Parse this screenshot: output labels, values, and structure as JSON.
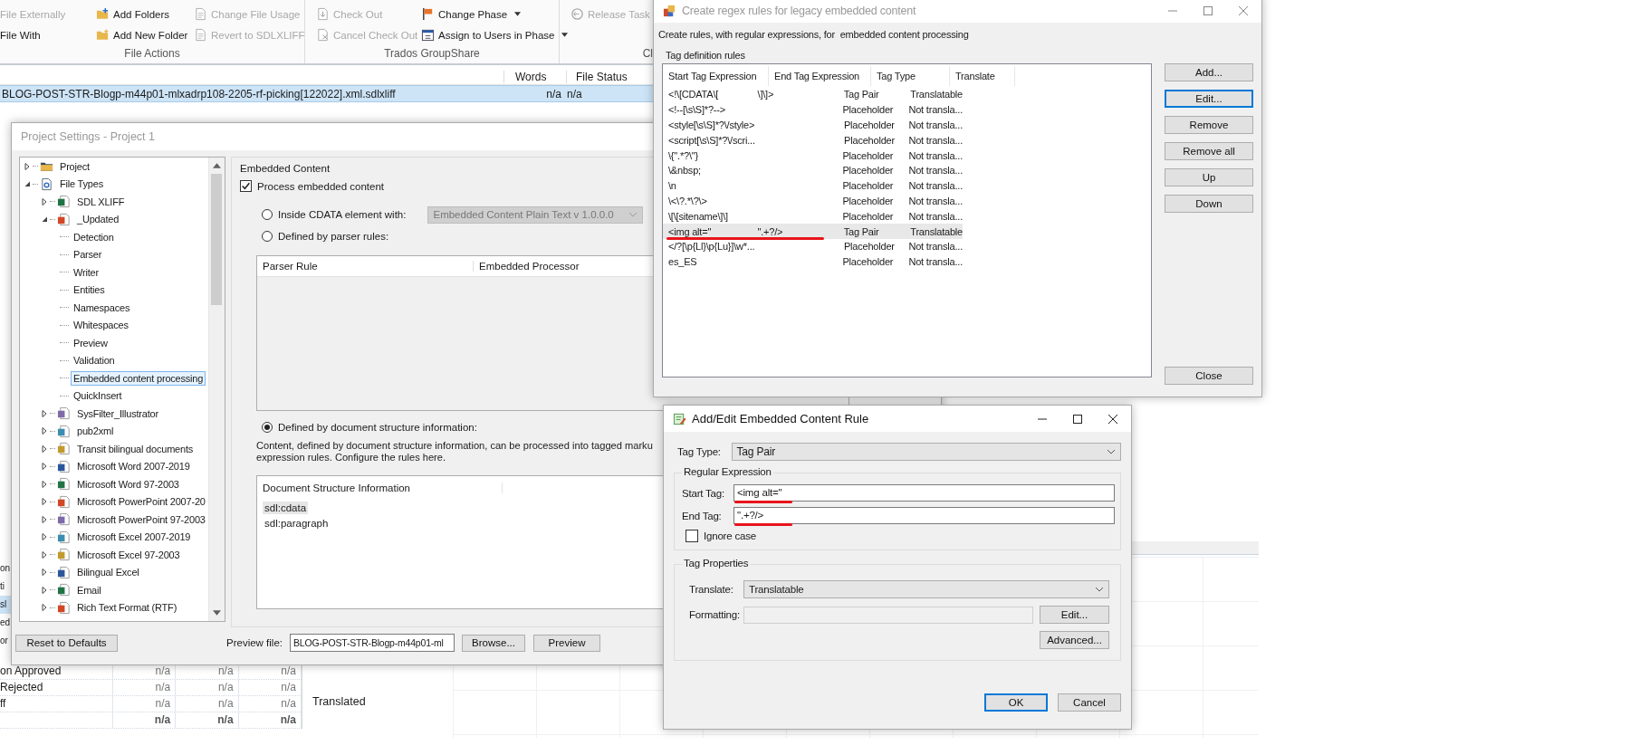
{
  "ribbon": {
    "groups": [
      {
        "label": "File Actions",
        "items": [
          {
            "label": "File Externally",
            "disabled": true,
            "dropdown": false
          },
          {
            "label": "File With",
            "disabled": false,
            "dropdown": false
          },
          {
            "label": "Add Folders",
            "disabled": false,
            "dropdown": false
          },
          {
            "label": "Add New Folder",
            "disabled": false,
            "dropdown": false
          },
          {
            "label": "Change File Usage",
            "disabled": true,
            "dropdown": false
          },
          {
            "label": "Revert to SDLXLIFF",
            "disabled": true,
            "dropdown": false
          }
        ]
      },
      {
        "label": "Trados GroupShare",
        "items": [
          {
            "label": "Check Out",
            "disabled": true,
            "dropdown": false
          },
          {
            "label": "Cancel Check Out",
            "disabled": true,
            "dropdown": false
          },
          {
            "label": "Change Phase",
            "disabled": false,
            "dropdown": true
          },
          {
            "label": "Assign to Users in Phase",
            "disabled": false,
            "dropdown": true
          }
        ]
      },
      {
        "label": "Cl",
        "items": [
          {
            "label": "Release Task",
            "disabled": true,
            "dropdown": false
          }
        ]
      }
    ]
  },
  "file_list": {
    "columns": [
      "Words",
      "File Status"
    ],
    "rows": [
      {
        "name": "BLOG-POST-STR-Blogp-m44p01-mlxadrp108-2205-rf-picking[122022].xml.sdlxliff",
        "words": "n/a",
        "file_status": "n/a",
        "selected": true
      }
    ]
  },
  "background_rows": [
    {
      "label": "on",
      "selected": false
    },
    {
      "label": "ti",
      "selected": false
    },
    {
      "label": "sl",
      "selected": true
    },
    {
      "label": "ed",
      "selected": false
    },
    {
      "label": "or",
      "selected": false
    }
  ],
  "stats_table": {
    "rows": [
      {
        "kind": "row",
        "label": "on Approved",
        "values": [
          "n/a",
          "n/a",
          "n/a"
        ]
      },
      {
        "kind": "row",
        "label": "Rejected",
        "values": [
          "n/a",
          "n/a",
          "n/a"
        ]
      },
      {
        "kind": "row",
        "label": "ff",
        "values": [
          "n/a",
          "n/a",
          "n/a"
        ]
      },
      {
        "kind": "total",
        "values": [
          "n/a",
          "n/a",
          "n/a"
        ]
      }
    ]
  },
  "status_panel": {
    "label": "Translated"
  },
  "project_settings": {
    "title": "Project Settings - Project 1",
    "active": false,
    "tree": [
      {
        "label": "Project",
        "expanded": false,
        "selected": false
      },
      {
        "label": "File Types",
        "expanded": true,
        "selected": false,
        "children": [
          {
            "label": "SDL XLIFF",
            "expanded": false,
            "selected": false
          },
          {
            "label": "_Updated",
            "expanded": true,
            "selected": false,
            "children": [
              {
                "label": "Detection",
                "selected": false
              },
              {
                "label": "Parser",
                "selected": false
              },
              {
                "label": "Writer",
                "selected": false
              },
              {
                "label": "Entities",
                "selected": false
              },
              {
                "label": "Namespaces",
                "selected": false
              },
              {
                "label": "Whitespaces",
                "selected": false
              },
              {
                "label": "Preview",
                "selected": false
              },
              {
                "label": "Validation",
                "selected": false
              },
              {
                "label": "Embedded content processing",
                "selected": true
              },
              {
                "label": "QuickInsert",
                "selected": false
              }
            ]
          },
          {
            "label": "SysFilter_Illustrator",
            "expanded": false,
            "selected": false
          },
          {
            "label": "pub2xml",
            "expanded": false,
            "selected": false
          },
          {
            "label": "Transit bilingual documents",
            "expanded": false,
            "selected": false
          },
          {
            "label": "Microsoft Word 2007-2019",
            "expanded": false,
            "selected": false
          },
          {
            "label": "Microsoft Word 97-2003",
            "expanded": false,
            "selected": false
          },
          {
            "label": "Microsoft PowerPoint 2007-20",
            "expanded": false,
            "selected": false
          },
          {
            "label": "Microsoft PowerPoint 97-2003",
            "expanded": false,
            "selected": false
          },
          {
            "label": "Microsoft Excel 2007-2019",
            "expanded": false,
            "selected": false
          },
          {
            "label": "Microsoft Excel 97-2003",
            "expanded": false,
            "selected": false
          },
          {
            "label": "Bilingual Excel",
            "expanded": false,
            "selected": false
          },
          {
            "label": "Email",
            "expanded": false,
            "selected": false
          },
          {
            "label": "Rich Text Format (RTF)",
            "expanded": false,
            "selected": false
          }
        ]
      }
    ],
    "section_title": "Embedded Content",
    "process_checkbox": {
      "label": "Process embedded content",
      "checked": true
    },
    "options": [
      {
        "kind": "cdata",
        "label": "Inside CDATA element with:",
        "selected": false,
        "dropdown": {
          "value": "Embedded Content Plain Text v 1.0.0.0",
          "disabled": true
        }
      },
      {
        "kind": "parser_rules",
        "label": "Defined by parser rules:",
        "selected": false,
        "columns": [
          "Parser Rule",
          "Embedded Processor"
        ]
      },
      {
        "kind": "structure",
        "label": "Defined by document structure information:",
        "selected": true,
        "description_lines": [
          "Content, defined by document structure information, can be processed into tagged marku",
          "expression rules. Configure the rules here."
        ],
        "table": {
          "column": "Document Structure Information",
          "rows": [
            {
              "value": "sdl:cdata",
              "selected": true
            },
            {
              "value": "sdl:paragraph",
              "selected": false
            }
          ]
        }
      }
    ],
    "reset_button": "Reset to Defaults",
    "preview": {
      "label": "Preview file:",
      "value": "BLOG-POST-STR-Blogp-m44p01-ml",
      "browse_button": "Browse...",
      "preview_button": "Preview"
    }
  },
  "regex_dialog": {
    "title": "Create regex rules for legacy embedded content",
    "active": false,
    "intro": "Create rules, with regular expressions, for  embedded content processing",
    "group_title": "Tag definition rules",
    "columns": [
      "Start Tag Expression",
      "End Tag Expression",
      "Tag Type",
      "Translate"
    ],
    "rows": [
      {
        "start": "<!\\[CDATA\\[",
        "end": "\\]\\]>",
        "tag_type": "Tag Pair",
        "translate": "Translatable",
        "selected": false,
        "underlined": false
      },
      {
        "start": "<!--[\\s\\S]*?-->",
        "tag_type": "Placeholder",
        "translate": "Not transla...",
        "selected": false,
        "underlined": false
      },
      {
        "start": "<style[\\s\\S]*?\\/style>",
        "tag_type": "Placeholder",
        "translate": "Not transla...",
        "selected": false,
        "underlined": false
      },
      {
        "start": "<script[\\s\\S]*?\\/scri...",
        "tag_type": "Placeholder",
        "translate": "Not transla...",
        "selected": false,
        "underlined": false
      },
      {
        "start": "\\{\".*?\\\"}",
        "tag_type": "Placeholder",
        "translate": "Not transla...",
        "selected": false,
        "underlined": false
      },
      {
        "start": "\\&nbsp;",
        "tag_type": "Placeholder",
        "translate": "Not transla...",
        "selected": false,
        "underlined": false
      },
      {
        "start": "\\n",
        "tag_type": "Placeholder",
        "translate": "Not transla...",
        "selected": false,
        "underlined": false
      },
      {
        "start": "\\<\\?.*\\?\\>",
        "tag_type": "Placeholder",
        "translate": "Not transla...",
        "selected": false,
        "underlined": false
      },
      {
        "start": "\\[\\[sitename\\]\\]",
        "tag_type": "Placeholder",
        "translate": "Not transla...",
        "selected": false,
        "underlined": false
      },
      {
        "start": "<img alt=\"",
        "end": "\".+?/>",
        "tag_type": "Tag Pair",
        "translate": "Translatable",
        "selected": true,
        "underlined": true
      },
      {
        "start": "</?[\\p{Ll}\\p{Lu}]\\w*...",
        "tag_type": "Placeholder",
        "translate": "Not transla...",
        "selected": false,
        "underlined": false
      },
      {
        "start": "es_ES",
        "tag_type": "Placeholder",
        "translate": "Not transla...",
        "selected": false,
        "underlined": false
      }
    ],
    "buttons": [
      {
        "label": "Add...",
        "focused": false
      },
      {
        "label": "Edit...",
        "focused": true
      },
      {
        "label": "Remove",
        "focused": false
      },
      {
        "label": "Remove all",
        "focused": false
      },
      {
        "label": "Up",
        "focused": false
      },
      {
        "label": "Down",
        "focused": false
      }
    ],
    "close_button": "Close"
  },
  "edit_dialog": {
    "title": "Add/Edit Embedded Content Rule",
    "active": true,
    "tag_type": {
      "label": "Tag Type:",
      "value": "Tag Pair"
    },
    "regex_group": {
      "title": "Regular Expression",
      "fields": [
        {
          "label": "Start Tag:",
          "value": "<img alt=\"",
          "underlined": true
        },
        {
          "label": "End Tag:",
          "value": "\".+?/>",
          "underlined": true
        }
      ],
      "ignore_case": {
        "label": "Ignore case",
        "checked": false
      }
    },
    "properties_group": {
      "title": "Tag Properties",
      "translate": {
        "label": "Translate:",
        "value": "Translatable"
      },
      "formatting": {
        "label": "Formatting:",
        "disabled": true,
        "button": "Edit..."
      },
      "advanced_button": "Advanced..."
    },
    "buttons": [
      {
        "label": "OK",
        "default": true
      },
      {
        "label": "Cancel",
        "default": false
      }
    ]
  }
}
